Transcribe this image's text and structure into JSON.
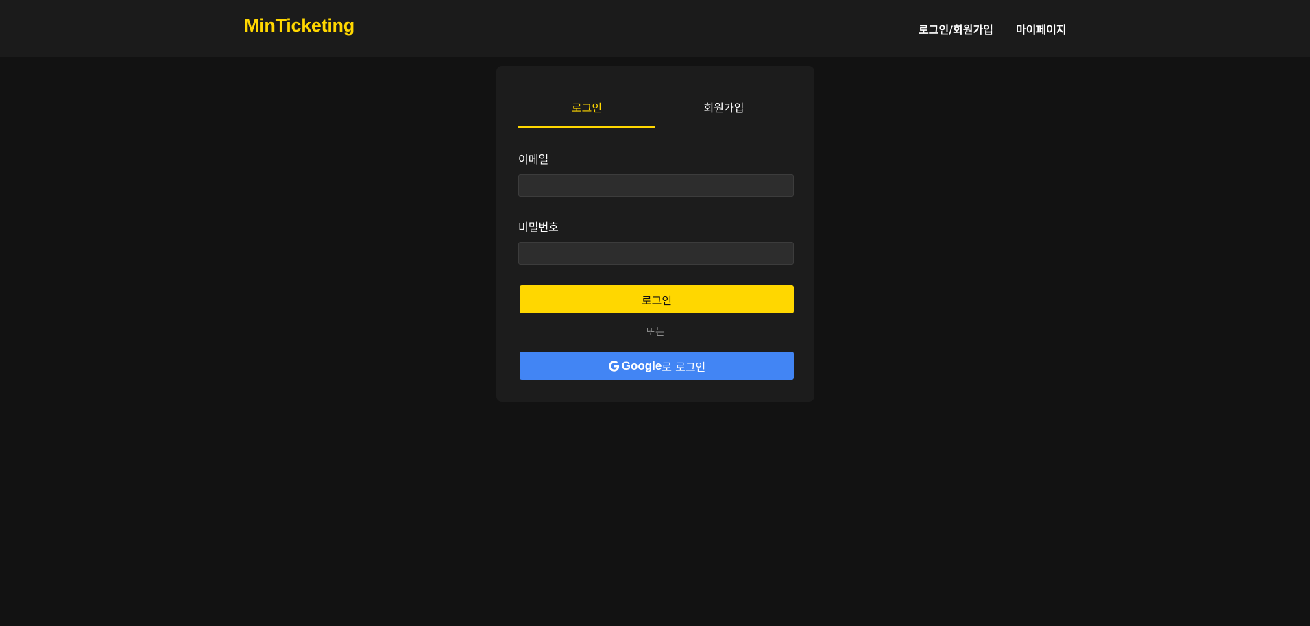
{
  "header": {
    "logo": "MinTicketing",
    "nav": {
      "login_signup": "로그인/회원가입",
      "mypage": "마이페이지"
    }
  },
  "auth_card": {
    "tabs": {
      "login": "로그인",
      "signup": "회원가입",
      "active": "login"
    },
    "email": {
      "label": "이메일",
      "value": "",
      "placeholder": ""
    },
    "password": {
      "label": "비밀번호",
      "value": "",
      "placeholder": ""
    },
    "login_button": "로그인",
    "divider_text": "또는",
    "google_button": {
      "icon": "google-g-icon",
      "brand": "Google",
      "suffix": "로 로그인"
    }
  },
  "colors": {
    "accent": "#ffd700",
    "google_blue": "#4285f4",
    "background": "#121212",
    "header_bg": "#1b1b1b",
    "card_bg": "#1c1c1c"
  }
}
